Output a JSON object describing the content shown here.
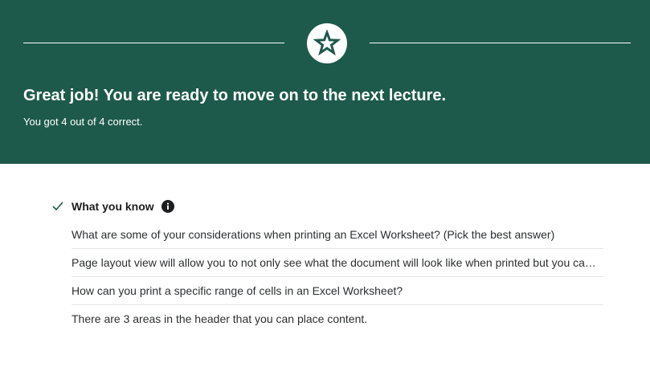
{
  "banner": {
    "headline": "Great job! You are ready to move on to the next lecture.",
    "score_text": "You got 4 out of 4 correct.",
    "badge_icon": "star-icon",
    "background_color": "#1e5a4b"
  },
  "section": {
    "title": "What you know",
    "status_icon": "check-icon",
    "info_icon": "info-icon"
  },
  "questions": [
    {
      "text": "What are some of your considerations when printing an Excel Worksheet? (Pick the best answer)"
    },
    {
      "text": "Page layout view will allow you to not only see what the document will look like when printed but you can also make changes to the header and footer."
    },
    {
      "text": "How can you print a specific range of cells in an Excel Worksheet?"
    },
    {
      "text": "There are 3 areas in the header that you can place content."
    }
  ]
}
